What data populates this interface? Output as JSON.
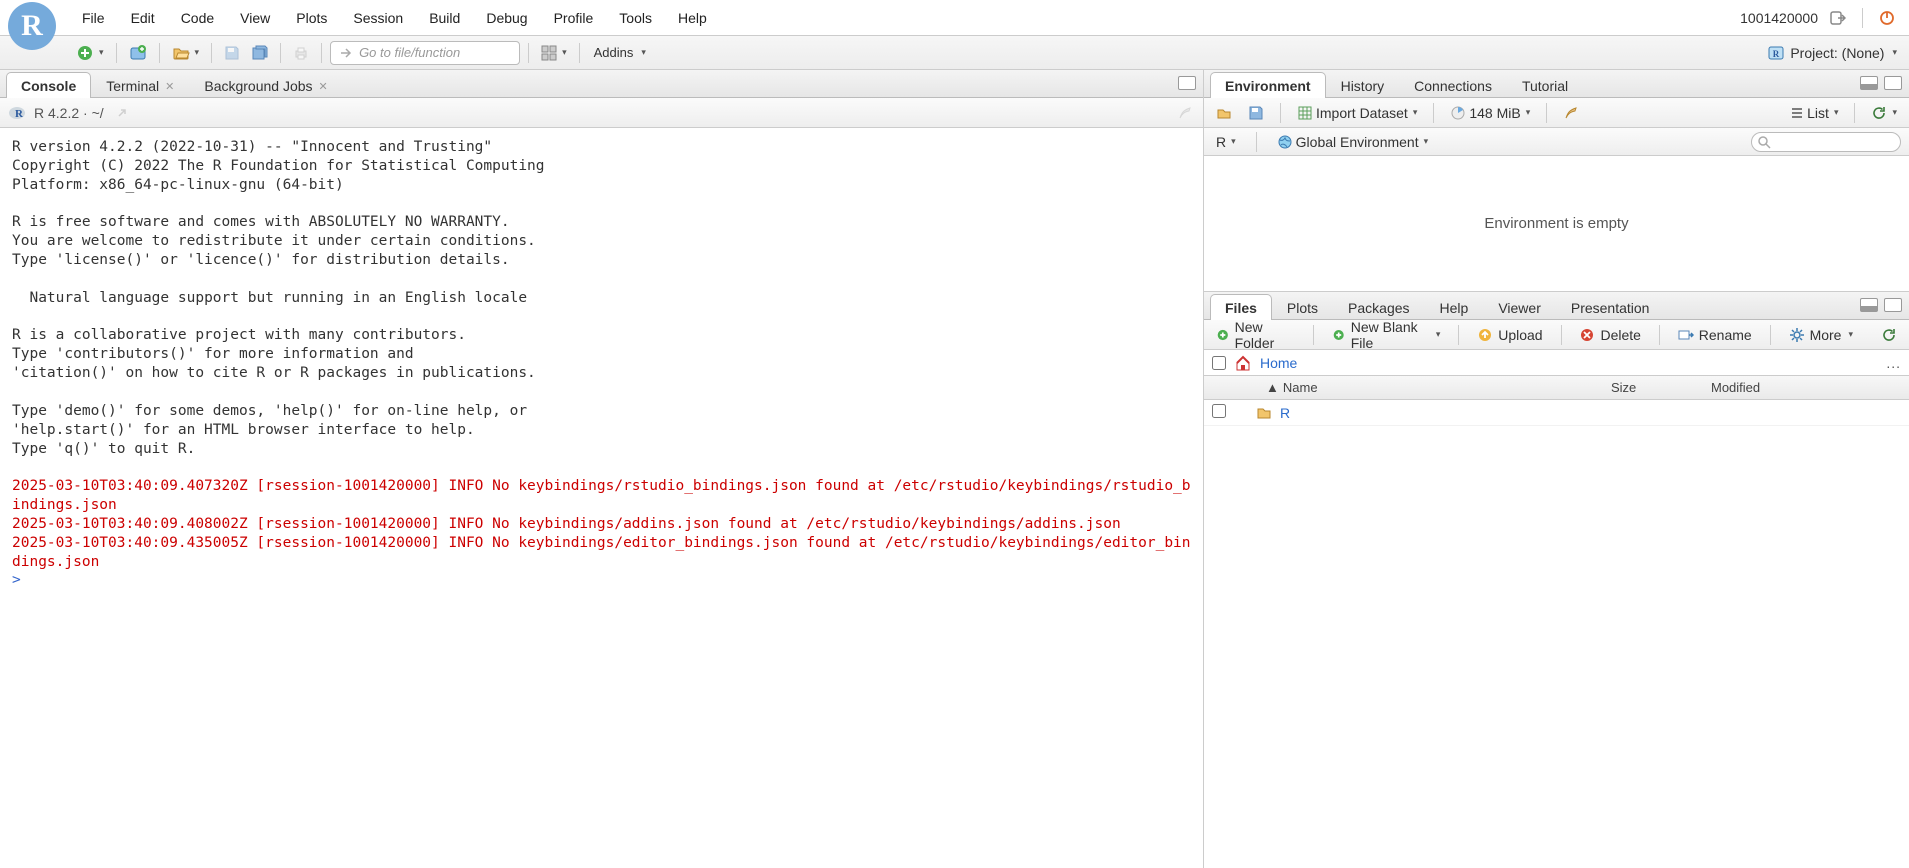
{
  "menubar": {
    "items": [
      "File",
      "Edit",
      "Code",
      "View",
      "Plots",
      "Session",
      "Build",
      "Debug",
      "Profile",
      "Tools",
      "Help"
    ],
    "session_id": "1001420000"
  },
  "toolbar": {
    "goto_placeholder": "Go to file/function",
    "addins_label": "Addins",
    "project_label": "Project: (None)"
  },
  "left": {
    "tabs": [
      {
        "label": "Console",
        "active": true,
        "closable": false
      },
      {
        "label": "Terminal",
        "active": false,
        "closable": true
      },
      {
        "label": "Background Jobs",
        "active": false,
        "closable": true
      }
    ],
    "console": {
      "version_label": "R 4.2.2",
      "cwd": "~/",
      "text_plain": "R version 4.2.2 (2022-10-31) -- \"Innocent and Trusting\"\nCopyright (C) 2022 The R Foundation for Statistical Computing\nPlatform: x86_64-pc-linux-gnu (64-bit)\n\nR is free software and comes with ABSOLUTELY NO WARRANTY.\nYou are welcome to redistribute it under certain conditions.\nType 'license()' or 'licence()' for distribution details.\n\n  Natural language support but running in an English locale\n\nR is a collaborative project with many contributors.\nType 'contributors()' for more information and\n'citation()' on how to cite R or R packages in publications.\n\nType 'demo()' for some demos, 'help()' for on-line help, or\n'help.start()' for an HTML browser interface to help.\nType 'q()' to quit R.\n",
      "text_err": "2025-03-10T03:40:09.407320Z [rsession-1001420000] INFO No keybindings/rstudio_bindings.json found at /etc/rstudio/keybindings/rstudio_bindings.json\n2025-03-10T03:40:09.408002Z [rsession-1001420000] INFO No keybindings/addins.json found at /etc/rstudio/keybindings/addins.json\n2025-03-10T03:40:09.435005Z [rsession-1001420000] INFO No keybindings/editor_bindings.json found at /etc/rstudio/keybindings/editor_bindings.json",
      "prompt": ">"
    }
  },
  "right_top": {
    "tabs": [
      {
        "label": "Environment",
        "active": true
      },
      {
        "label": "History",
        "active": false
      },
      {
        "label": "Connections",
        "active": false
      },
      {
        "label": "Tutorial",
        "active": false
      }
    ],
    "import_label": "Import Dataset",
    "memory_label": "148 MiB",
    "view_mode": "List",
    "lang_label": "R",
    "scope_label": "Global Environment",
    "empty_message": "Environment is empty",
    "search_placeholder": ""
  },
  "right_bottom": {
    "tabs": [
      {
        "label": "Files",
        "active": true
      },
      {
        "label": "Plots",
        "active": false
      },
      {
        "label": "Packages",
        "active": false
      },
      {
        "label": "Help",
        "active": false
      },
      {
        "label": "Viewer",
        "active": false
      },
      {
        "label": "Presentation",
        "active": false
      }
    ],
    "buttons": {
      "new_folder": "New Folder",
      "new_blank": "New Blank File",
      "upload": "Upload",
      "delete": "Delete",
      "rename": "Rename",
      "more": "More"
    },
    "breadcrumb": {
      "home": "Home"
    },
    "columns": {
      "name": "Name",
      "size": "Size",
      "modified": "Modified"
    },
    "rows": [
      {
        "name": "R",
        "type": "folder",
        "size": "",
        "modified": ""
      }
    ]
  }
}
